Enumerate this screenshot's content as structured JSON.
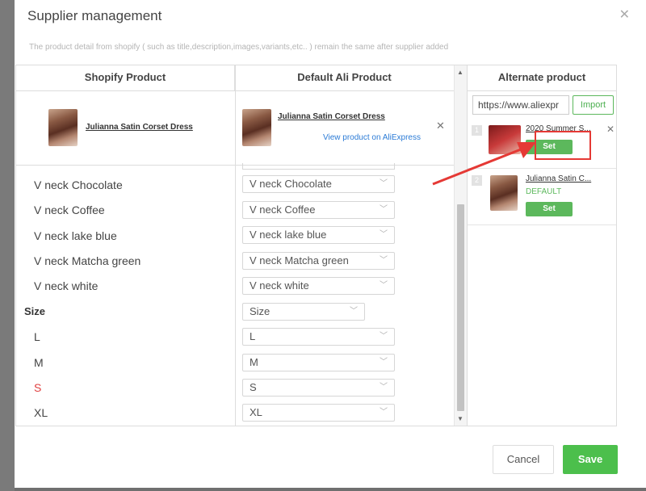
{
  "modal": {
    "title": "Supplier management",
    "close_icon": "close-icon",
    "subtitle": "The product detail from shopify ( such as title,description,images,variants,etc.. ) remain the same after supplier added"
  },
  "table": {
    "col_shopify": "Shopify Product",
    "col_ali": "Default Ali Product",
    "shopify_product_name": "Julianna Satin Corset Dress",
    "ali_product_name": "Julianna Satin Corset Dress",
    "view_link": "View product on AliExpress",
    "remove_icon": "close-icon",
    "variants": [
      {
        "label": "V neck Chocolate",
        "value": "V neck Chocolate"
      },
      {
        "label": "V neck Coffee",
        "value": "V neck Coffee"
      },
      {
        "label": "V neck lake blue",
        "value": "V neck lake blue"
      },
      {
        "label": "V neck Matcha green",
        "value": "V neck Matcha green"
      },
      {
        "label": "V neck white",
        "value": "V neck white"
      }
    ],
    "option_group": {
      "label": "Size",
      "value": "Size"
    },
    "sizes": [
      {
        "label": "L",
        "value": "L"
      },
      {
        "label": "M",
        "value": "M"
      },
      {
        "label": "S",
        "value": "S",
        "highlight_color": "#e04040"
      },
      {
        "label": "XL",
        "value": "XL"
      }
    ]
  },
  "alternate": {
    "header": "Alternate product",
    "url_value": "https://www.aliexpr",
    "import_label": "Import",
    "items": [
      {
        "num": "1",
        "name": "2020 Summer S...",
        "set_label": "Set"
      },
      {
        "num": "2",
        "name": "Julianna Satin C...",
        "tag": "DEFAULT",
        "set_label": "Set"
      }
    ]
  },
  "footer": {
    "cancel_label": "Cancel",
    "save_label": "Save"
  },
  "colors": {
    "accent_green": "#4cbf4c",
    "link_blue": "#2b7bd6",
    "annotation_red": "#e53935"
  }
}
